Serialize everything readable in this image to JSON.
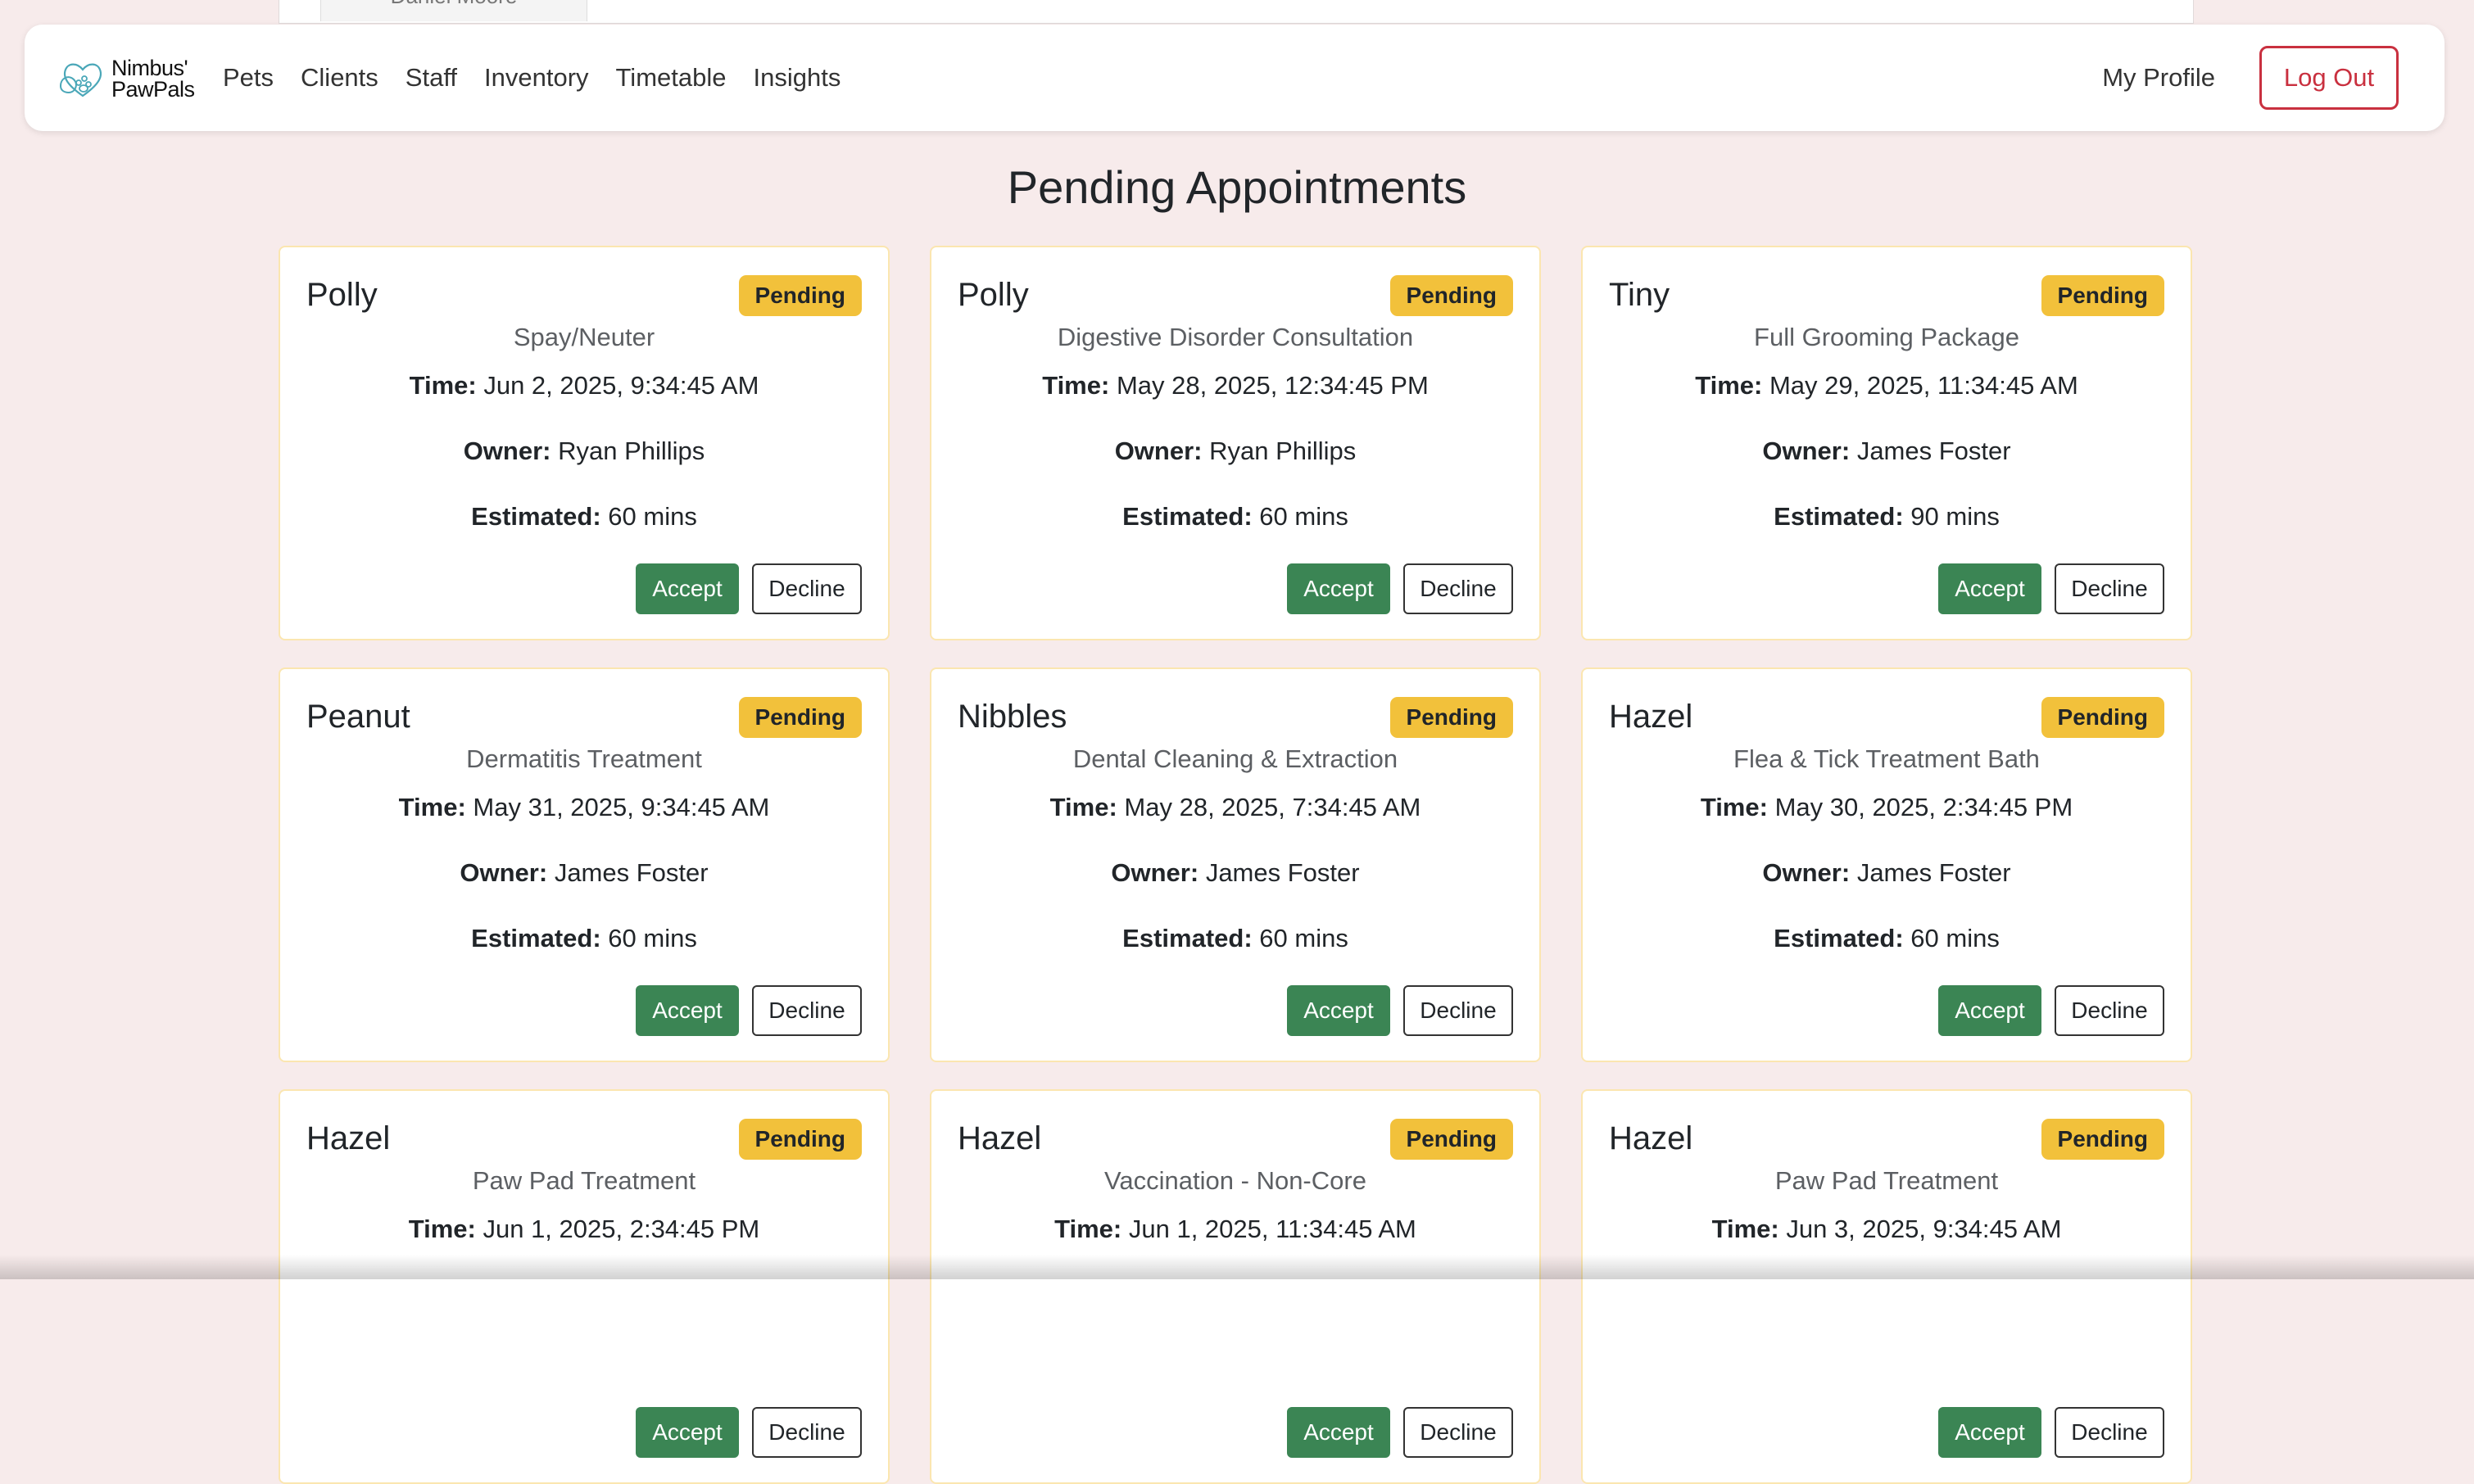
{
  "behind_panel": {
    "tab_label": "Daniel Moore"
  },
  "navbar": {
    "brand": {
      "line1": "Nimbus'",
      "line2": "PawPals"
    },
    "links": [
      {
        "id": "pets",
        "label": "Pets"
      },
      {
        "id": "clients",
        "label": "Clients"
      },
      {
        "id": "staff",
        "label": "Staff"
      },
      {
        "id": "inventory",
        "label": "Inventory"
      },
      {
        "id": "timetable",
        "label": "Timetable"
      },
      {
        "id": "insights",
        "label": "Insights"
      }
    ],
    "profile_label": "My Profile",
    "logout_label": "Log Out"
  },
  "page": {
    "title": "Pending Appointments"
  },
  "labels": {
    "time": "Time:",
    "owner": "Owner:",
    "estimated": "Estimated:",
    "accept": "Accept",
    "decline": "Decline"
  },
  "colors": {
    "background": "#f7ebeb",
    "badge": "#f2c13b",
    "accept": "#3b8554",
    "logout": "#c9303f",
    "card_border": "#fbe6b0"
  },
  "appointments": [
    {
      "pet": "Polly",
      "status": "Pending",
      "service": "Spay/Neuter",
      "time": "Jun 2, 2025, 9:34:45 AM",
      "owner": "Ryan Phillips",
      "estimated": "60 mins"
    },
    {
      "pet": "Polly",
      "status": "Pending",
      "service": "Digestive Disorder Consultation",
      "time": "May 28, 2025, 12:34:45 PM",
      "owner": "Ryan Phillips",
      "estimated": "60 mins"
    },
    {
      "pet": "Tiny",
      "status": "Pending",
      "service": "Full Grooming Package",
      "time": "May 29, 2025, 11:34:45 AM",
      "owner": "James Foster",
      "estimated": "90 mins"
    },
    {
      "pet": "Peanut",
      "status": "Pending",
      "service": "Dermatitis Treatment",
      "time": "May 31, 2025, 9:34:45 AM",
      "owner": "James Foster",
      "estimated": "60 mins"
    },
    {
      "pet": "Nibbles",
      "status": "Pending",
      "service": "Dental Cleaning & Extraction",
      "time": "May 28, 2025, 7:34:45 AM",
      "owner": "James Foster",
      "estimated": "60 mins"
    },
    {
      "pet": "Hazel",
      "status": "Pending",
      "service": "Flea & Tick Treatment Bath",
      "time": "May 30, 2025, 2:34:45 PM",
      "owner": "James Foster",
      "estimated": "60 mins"
    },
    {
      "pet": "Hazel",
      "status": "Pending",
      "service": "Paw Pad Treatment",
      "time": "Jun 1, 2025, 2:34:45 PM",
      "owner": "",
      "estimated": ""
    },
    {
      "pet": "Hazel",
      "status": "Pending",
      "service": "Vaccination - Non-Core",
      "time": "Jun 1, 2025, 11:34:45 AM",
      "owner": "",
      "estimated": ""
    },
    {
      "pet": "Hazel",
      "status": "Pending",
      "service": "Paw Pad Treatment",
      "time": "Jun 3, 2025, 9:34:45 AM",
      "owner": "",
      "estimated": ""
    }
  ]
}
